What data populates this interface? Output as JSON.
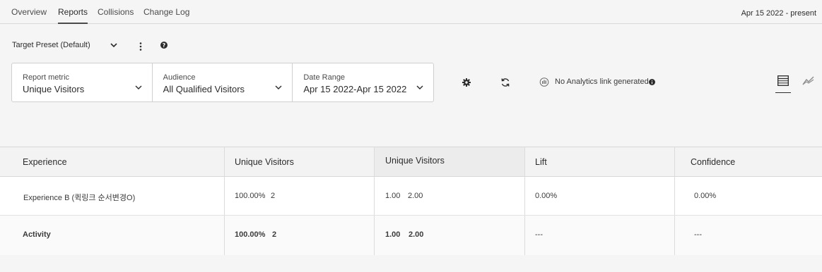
{
  "tabs": [
    {
      "label": "Overview"
    },
    {
      "label": "Reports"
    },
    {
      "label": "Collisions"
    },
    {
      "label": "Change Log"
    }
  ],
  "active_tab": "Reports",
  "date_range_top": "Apr 15 2022 - present",
  "preset": {
    "label": "Target Preset (Default)"
  },
  "selectors": {
    "metric": {
      "label": "Report metric",
      "value": "Unique Visitors"
    },
    "audience": {
      "label": "Audience",
      "value": "All Qualified Visitors"
    },
    "date": {
      "label": "Date Range",
      "value": "Apr 15 2022-Apr 15 2022"
    }
  },
  "analytics": {
    "text": "No Analytics link generated"
  },
  "table": {
    "headers": [
      "Experience",
      "Unique Visitors",
      "Unique Visitors",
      "Lift",
      "Confidence"
    ],
    "rows": [
      {
        "experience": "Experience B (퀵링크 순서변경O)",
        "pct": "100.00%",
        "count": "2",
        "ratio": "1.00",
        "total": "2.00",
        "lift": "0.00%",
        "confidence": "0.00%"
      },
      {
        "experience": "Activity",
        "pct": "100.00%",
        "count": "2",
        "ratio": "1.00",
        "total": "2.00",
        "lift": "---",
        "confidence": "---"
      }
    ]
  },
  "icons": {
    "preset_chevron": "chevron-down-icon",
    "more": "more-vertical-icon",
    "help": "help-icon",
    "settings": "gear-icon",
    "refresh": "refresh-icon",
    "analytics": "analytics-icon",
    "info": "info-icon",
    "table_view": "table-view-icon",
    "chart_view": "line-chart-icon"
  }
}
